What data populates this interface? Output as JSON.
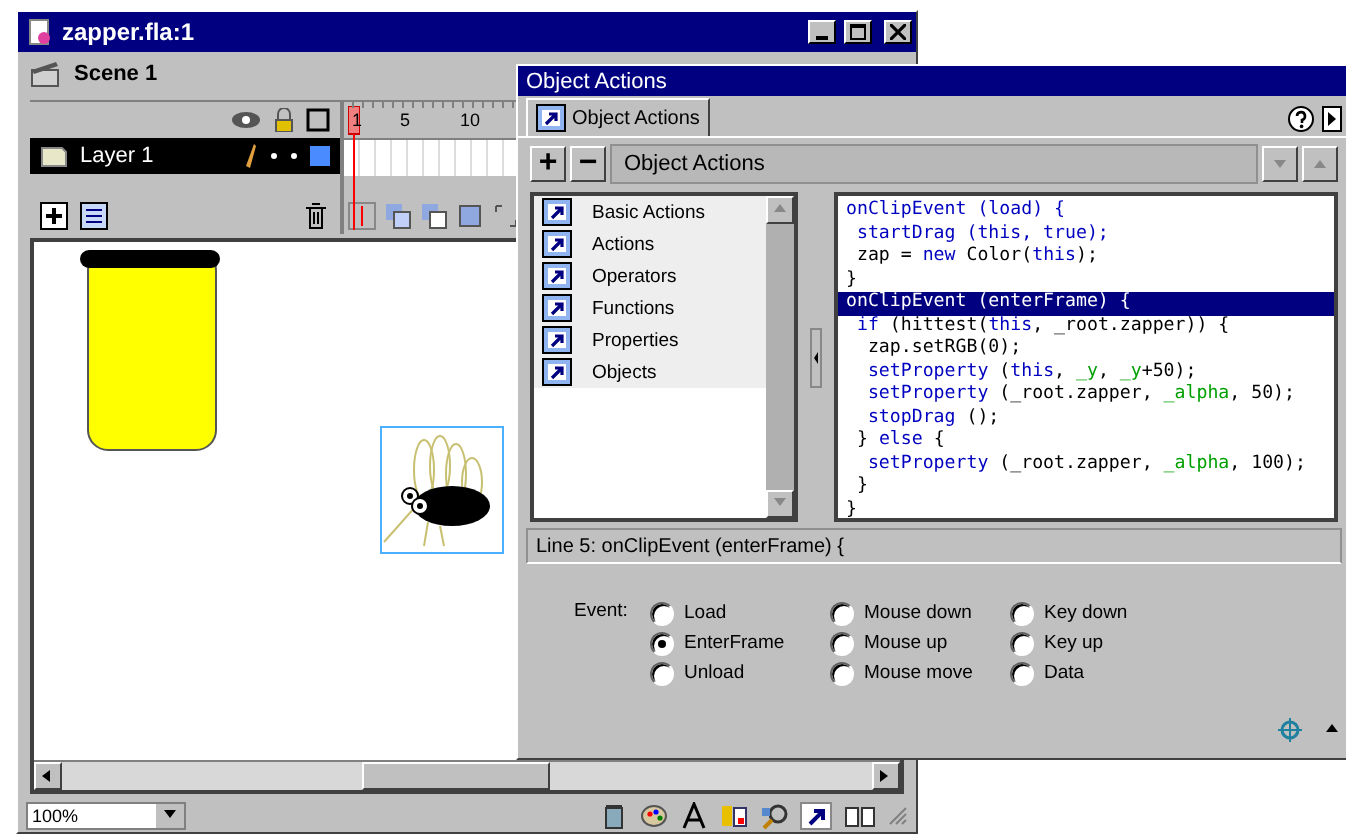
{
  "main_window": {
    "title": "zapper.fla:1",
    "scene": "Scene 1",
    "timeline": {
      "frame_numbers": [
        "1",
        "5",
        "10"
      ],
      "layers": [
        {
          "name": "Layer 1",
          "selected": true
        }
      ]
    },
    "zoom": "100%"
  },
  "actions_panel": {
    "title": "Object Actions",
    "tabs": [
      {
        "label": "Object Actions",
        "selected": true
      }
    ],
    "add_button": "+",
    "remove_button": "−",
    "dropdown": "Object Actions",
    "categories": [
      "Basic Actions",
      "Actions",
      "Operators",
      "Functions",
      "Properties",
      "Objects"
    ],
    "code_lines": [
      {
        "selected": false,
        "segments": [
          {
            "kind": "keyword",
            "text": "onClipEvent (load) {"
          }
        ]
      },
      {
        "selected": false,
        "segments": [
          {
            "kind": "keyword",
            "text": " startDrag (this, true);"
          }
        ]
      },
      {
        "selected": false,
        "segments": [
          {
            "kind": "plain",
            "text": " zap = "
          },
          {
            "kind": "keyword",
            "text": "new"
          },
          {
            "kind": "plain",
            "text": " Color("
          },
          {
            "kind": "keyword",
            "text": "this"
          },
          {
            "kind": "plain",
            "text": ");"
          }
        ]
      },
      {
        "selected": false,
        "segments": [
          {
            "kind": "plain",
            "text": "}"
          }
        ]
      },
      {
        "selected": true,
        "segments": [
          {
            "kind": "keyword",
            "text": "onClipEvent (enterFrame) {"
          }
        ]
      },
      {
        "selected": false,
        "segments": [
          {
            "kind": "keyword",
            "text": " if"
          },
          {
            "kind": "plain",
            "text": " (hittest("
          },
          {
            "kind": "keyword",
            "text": "this"
          },
          {
            "kind": "plain",
            "text": ", _root.zapper)) {"
          }
        ]
      },
      {
        "selected": false,
        "segments": [
          {
            "kind": "plain",
            "text": "  zap.setRGB(0);"
          }
        ]
      },
      {
        "selected": false,
        "segments": [
          {
            "kind": "keyword",
            "text": "  setProperty"
          },
          {
            "kind": "plain",
            "text": " ("
          },
          {
            "kind": "keyword",
            "text": "this"
          },
          {
            "kind": "plain",
            "text": ", "
          },
          {
            "kind": "property",
            "text": "_y"
          },
          {
            "kind": "plain",
            "text": ", "
          },
          {
            "kind": "property",
            "text": "_y"
          },
          {
            "kind": "plain",
            "text": "+50);"
          }
        ]
      },
      {
        "selected": false,
        "segments": [
          {
            "kind": "keyword",
            "text": "  setProperty"
          },
          {
            "kind": "plain",
            "text": " (_root.zapper, "
          },
          {
            "kind": "property",
            "text": "_alpha"
          },
          {
            "kind": "plain",
            "text": ", 50);"
          }
        ]
      },
      {
        "selected": false,
        "segments": [
          {
            "kind": "keyword",
            "text": "  stopDrag"
          },
          {
            "kind": "plain",
            "text": " ();"
          }
        ]
      },
      {
        "selected": false,
        "segments": [
          {
            "kind": "plain",
            "text": " } "
          },
          {
            "kind": "keyword",
            "text": "else"
          },
          {
            "kind": "plain",
            "text": " {"
          }
        ]
      },
      {
        "selected": false,
        "segments": [
          {
            "kind": "keyword",
            "text": "  setProperty"
          },
          {
            "kind": "plain",
            "text": " (_root.zapper, "
          },
          {
            "kind": "property",
            "text": "_alpha"
          },
          {
            "kind": "plain",
            "text": ", 100);"
          }
        ]
      },
      {
        "selected": false,
        "segments": [
          {
            "kind": "plain",
            "text": " }"
          }
        ]
      },
      {
        "selected": false,
        "segments": [
          {
            "kind": "plain",
            "text": "}"
          }
        ]
      }
    ],
    "status": "Line 5: onClipEvent (enterFrame) {",
    "event_label": "Event:",
    "event_columns": [
      [
        {
          "label": "Load",
          "selected": false
        },
        {
          "label": "EnterFrame",
          "selected": true
        },
        {
          "label": "Unload",
          "selected": false
        }
      ],
      [
        {
          "label": "Mouse down",
          "selected": false
        },
        {
          "label": "Mouse up",
          "selected": false
        },
        {
          "label": "Mouse move",
          "selected": false
        }
      ],
      [
        {
          "label": "Key down",
          "selected": false
        },
        {
          "label": "Key up",
          "selected": false
        },
        {
          "label": "Data",
          "selected": false
        }
      ]
    ]
  }
}
